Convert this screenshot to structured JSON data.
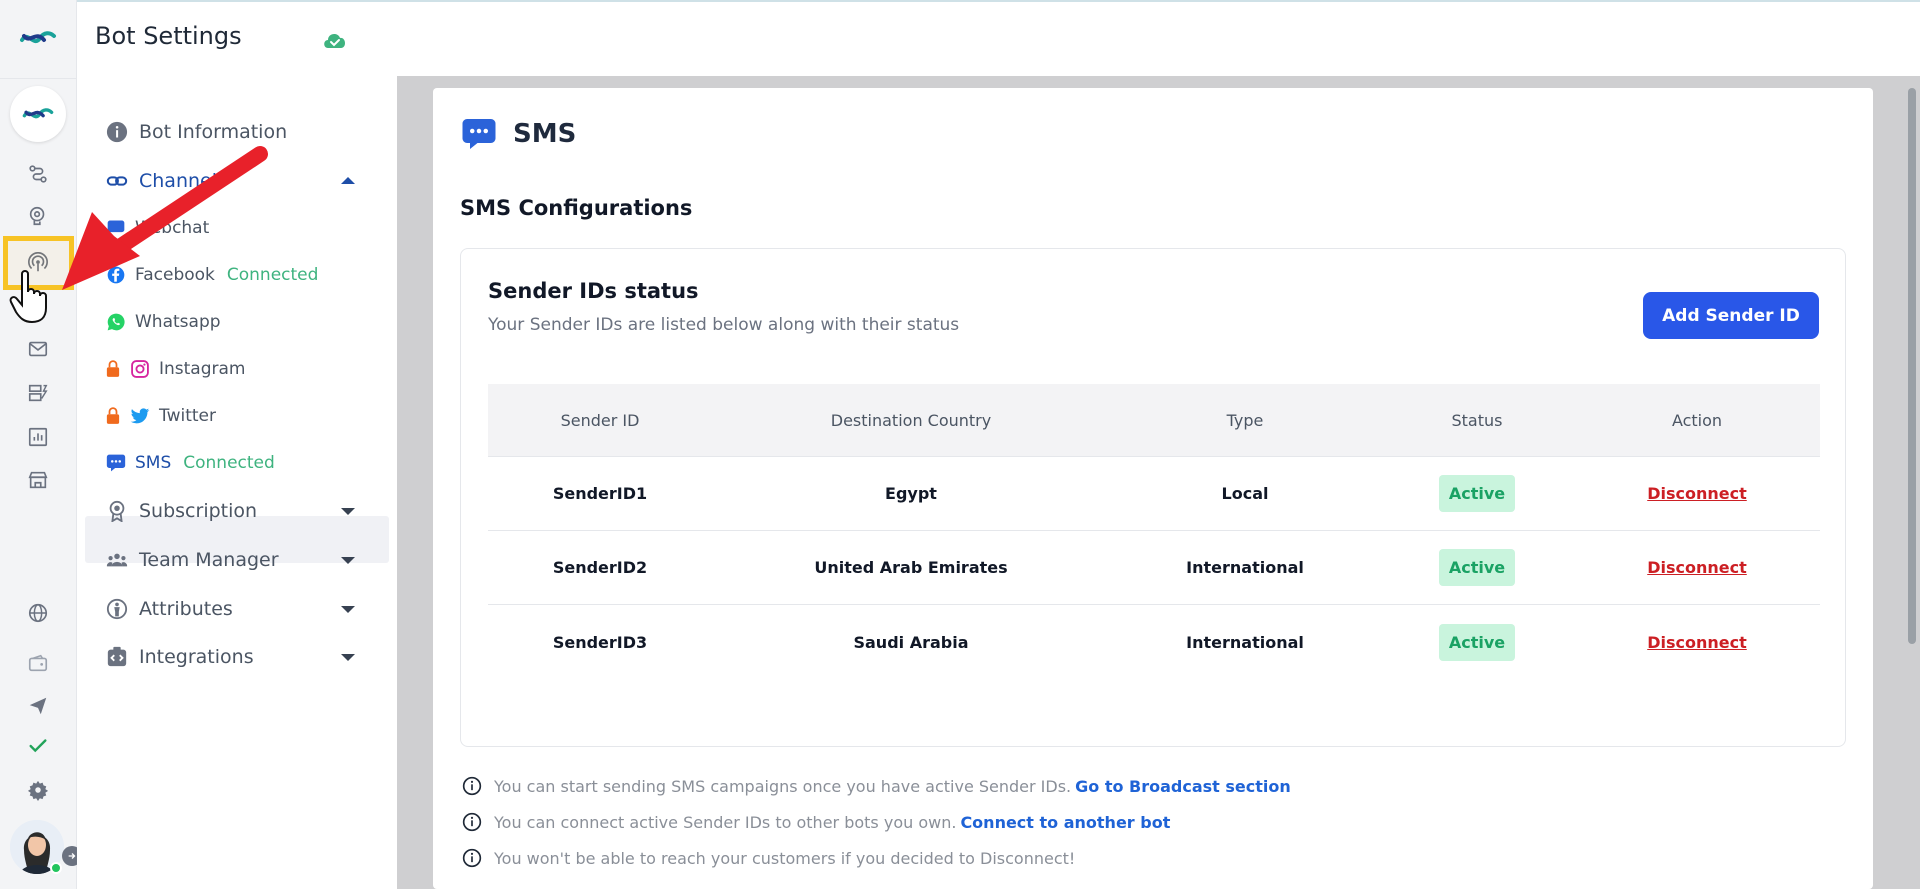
{
  "header": {
    "title": "Bot Settings",
    "saved_icon": "cloud-check-icon"
  },
  "rail": {
    "icons": [
      "logo-icon",
      "bot-avatar-icon",
      "flow-icon",
      "brain-icon",
      "channels-icon",
      "mail-icon",
      "broadcast-icon",
      "analytics-icon",
      "store-icon",
      "globe-icon",
      "wallet-icon",
      "send-icon",
      "check-icon",
      "settings-icon"
    ]
  },
  "menu": {
    "bot_information": "Bot Information",
    "channels": "Channels",
    "webchat": "Webchat",
    "facebook": "Facebook",
    "facebook_status": "Connected",
    "whatsapp": "Whatsapp",
    "instagram": "Instagram",
    "twitter": "Twitter",
    "sms": "SMS",
    "sms_status": "Connected",
    "subscription": "Subscription",
    "team_manager": "Team Manager",
    "attributes": "Attributes",
    "integrations": "Integrations"
  },
  "main": {
    "title": "SMS",
    "config_title": "SMS Configurations",
    "status_title": "Sender IDs status",
    "status_subtitle": "Your Sender IDs are listed below along with their status",
    "add_button": "Add Sender ID",
    "table": {
      "headers": [
        "Sender ID",
        "Destination Country",
        "Type",
        "Status",
        "Action"
      ],
      "rows": [
        {
          "sender_id": "SenderID1",
          "country": "Egypt",
          "type": "Local",
          "status": "Active",
          "action": "Disconnect"
        },
        {
          "sender_id": "SenderID2",
          "country": "United Arab Emirates",
          "type": "International",
          "status": "Active",
          "action": "Disconnect"
        },
        {
          "sender_id": "SenderID3",
          "country": "Saudi Arabia",
          "type": "International",
          "status": "Active",
          "action": "Disconnect"
        }
      ]
    },
    "notes": [
      {
        "text": "You can start sending SMS campaigns once you have active Sender IDs.",
        "link": "Go to Broadcast section"
      },
      {
        "text": "You can connect active Sender IDs to other bots you own.",
        "link": "Connect to another bot"
      },
      {
        "text": "You won't be able to reach your customers if you decided to Disconnect!",
        "link": ""
      }
    ]
  },
  "colors": {
    "primary": "#2957e8",
    "connected": "#3eb37f",
    "active_bg": "#c9f4dd",
    "danger": "#cc1f24",
    "highlight": "#f7c325",
    "annotation": "#e8212a"
  }
}
